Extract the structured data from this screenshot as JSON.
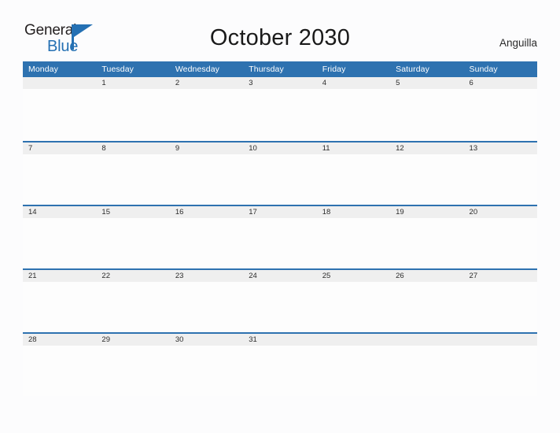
{
  "brand": {
    "name_top": "General",
    "name_bottom": "Blue",
    "top_color": "#231f20",
    "bottom_color": "#2470b3",
    "flag_color": "#2470b3"
  },
  "header": {
    "title": "October 2030",
    "region": "Anguilla"
  },
  "colors": {
    "header_blue": "#2e72b0",
    "date_strip_gray": "#efefef",
    "page_background": "#fcfcfd",
    "title_text": "#1a1a1a"
  },
  "calendar": {
    "month": "October",
    "year": "2030",
    "weekday_headers": [
      "Monday",
      "Tuesday",
      "Wednesday",
      "Thursday",
      "Friday",
      "Saturday",
      "Sunday"
    ],
    "weeks": [
      [
        "",
        "1",
        "2",
        "3",
        "4",
        "5",
        "6"
      ],
      [
        "7",
        "8",
        "9",
        "10",
        "11",
        "12",
        "13"
      ],
      [
        "14",
        "15",
        "16",
        "17",
        "18",
        "19",
        "20"
      ],
      [
        "21",
        "22",
        "23",
        "24",
        "25",
        "26",
        "27"
      ],
      [
        "28",
        "29",
        "30",
        "31",
        "",
        "",
        ""
      ]
    ]
  }
}
